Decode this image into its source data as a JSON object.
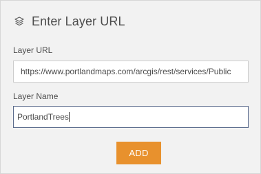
{
  "dialog": {
    "icon": "layers-icon",
    "title": "Enter Layer URL"
  },
  "url_field": {
    "label": "Layer URL",
    "value": "https://www.portlandmaps.com/arcgis/rest/services/Public"
  },
  "name_field": {
    "label": "Layer Name",
    "value": "PortlandTrees"
  },
  "actions": {
    "add_label": "ADD",
    "add_color": "#e8912d"
  }
}
